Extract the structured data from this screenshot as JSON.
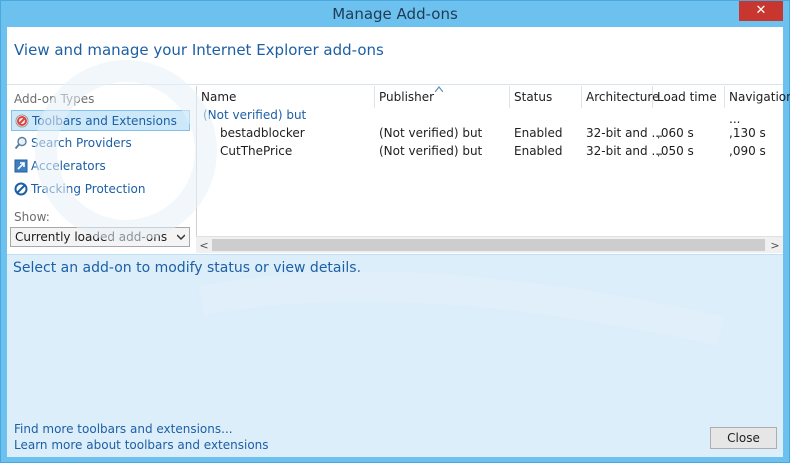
{
  "window": {
    "title": "Manage Add-ons",
    "close_glyph": "✕"
  },
  "header": {
    "text": "View and manage your Internet Explorer add-ons"
  },
  "sidebar": {
    "types_label": "Add-on Types",
    "items": [
      {
        "label": "Toolbars and Extensions",
        "icon": "toolbars-extensions-icon",
        "selected": true
      },
      {
        "label": "Search Providers",
        "icon": "search-icon",
        "selected": false
      },
      {
        "label": "Accelerators",
        "icon": "accelerator-icon",
        "selected": false
      },
      {
        "label": "Tracking Protection",
        "icon": "tracking-protection-icon",
        "selected": false
      }
    ],
    "show_label": "Show:",
    "show_value": "Currently loaded add-ons"
  },
  "list": {
    "columns": [
      "Name",
      "Publisher",
      "Status",
      "Architecture",
      "Load time",
      "Navigation ..."
    ],
    "group": "(Not verified) but",
    "rows": [
      {
        "name": "bestadblocker",
        "publisher": "(Not verified) but",
        "status": "Enabled",
        "architecture": "32-bit and ...",
        "load_time": ",060 s",
        "navigation": ",130 s"
      },
      {
        "name": "CutThePrice",
        "publisher": "(Not verified) but",
        "status": "Enabled",
        "architecture": "32-bit and ...",
        "load_time": ",050 s",
        "navigation": ",090 s"
      }
    ],
    "scroll_left": "<",
    "scroll_right": ">"
  },
  "detail": {
    "text": "Select an add-on to modify status or view details."
  },
  "footer": {
    "link1": "Find more toolbars and extensions...",
    "link2": "Learn more about toolbars and extensions",
    "close_label": "Close"
  },
  "colors": {
    "accent": "#1d5fa6",
    "title_bar": "#6cc1ef",
    "close_red": "#c7372f",
    "detail_bg": "#dceefa"
  }
}
